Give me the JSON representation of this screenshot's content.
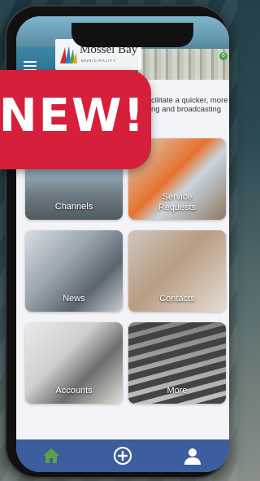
{
  "app": {
    "title": "Mossel Bay",
    "subtitle": "MUNICIPALITY",
    "notification_count": "6"
  },
  "intro_text": "cilitate a quicker, more ng and broadcasting",
  "banner": {
    "text": "NEW!"
  },
  "tiles": [
    {
      "label": "Channels"
    },
    {
      "label": "Service Requests"
    },
    {
      "label": "News"
    },
    {
      "label": "Contacts"
    },
    {
      "label": "Accounts"
    },
    {
      "label": "More"
    }
  ],
  "bottom_nav": [
    {
      "icon": "home-icon",
      "color": "#5aa04a"
    },
    {
      "icon": "plus-circle-icon",
      "color": "#ffffff"
    },
    {
      "icon": "user-icon",
      "color": "#ffffff"
    }
  ],
  "colors": {
    "nav_bar": "#3c5d9e",
    "banner": "#d61f3a",
    "background": "#f3f4f7"
  }
}
